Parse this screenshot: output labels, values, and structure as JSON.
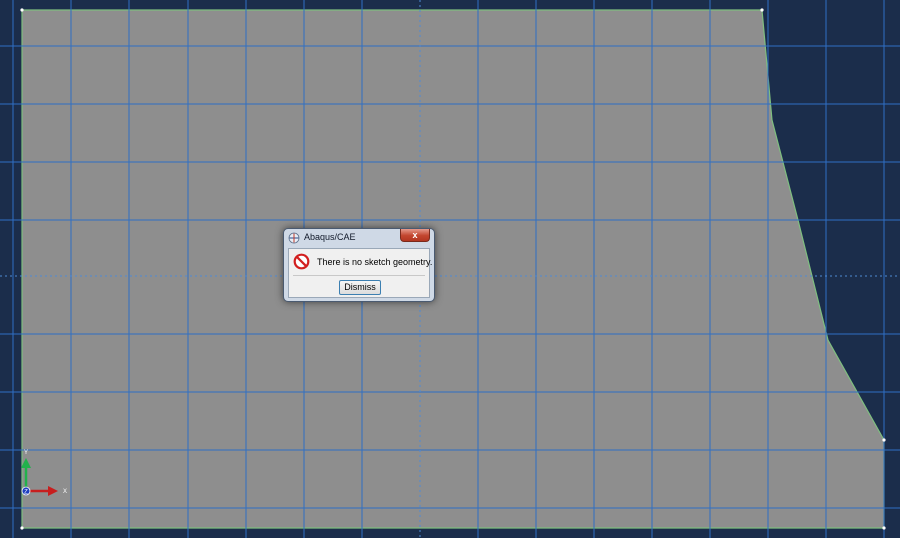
{
  "dialog": {
    "title": "Abaqus/CAE",
    "close_label": "x",
    "message": "There is no sketch geometry.",
    "dismiss_label": "Dismiss"
  },
  "triad": {
    "y_label": "Y",
    "x_label": "X",
    "z_label": "Z"
  },
  "colors": {
    "background": "#1b2d4b",
    "grid_line": "#2f6fc4",
    "sketch_fill": "#8e8e8e",
    "sketch_edge": "#7fbf7f",
    "y_axis": "#22b14c",
    "x_axis": "#c81e1e",
    "z_axis": "#1f3fbf"
  }
}
